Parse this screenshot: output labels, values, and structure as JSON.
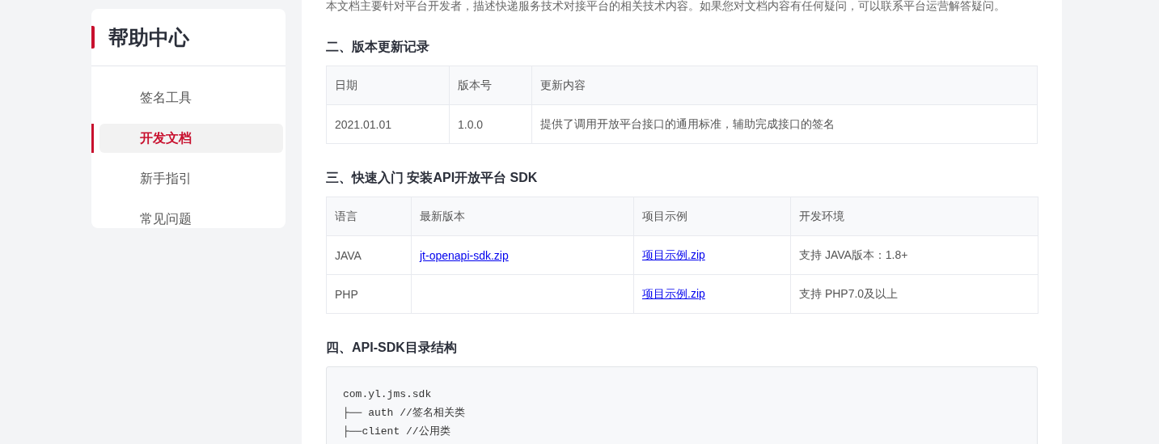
{
  "sidebar": {
    "title": "帮助中心",
    "items": [
      {
        "label": "签名工具",
        "selected": false
      },
      {
        "label": "开发文档",
        "selected": true
      },
      {
        "label": "新手指引",
        "selected": false
      },
      {
        "label": "常见问题",
        "selected": false
      }
    ]
  },
  "intro": "本文档主要针对平台开发者，描述快递服务技术对接平台的相关技术内容。如果您对文档内容有任何疑问，可以联系平台运营解答疑问。",
  "sections": [
    {
      "heading": "二、版本更新记录",
      "kind": "table",
      "table": {
        "columns": [
          "日期",
          "版本号",
          "更新内容"
        ],
        "rows": [
          [
            {
              "text": "2021.01.01"
            },
            {
              "text": "1.0.0"
            },
            {
              "text": "提供了调用开放平台接口的通用标准，辅助完成接口的签名"
            }
          ]
        ]
      }
    },
    {
      "heading": "三、快速入门 安装API开放平台 SDK",
      "kind": "table",
      "table": {
        "columns": [
          "语言",
          "最新版本",
          "项目示例",
          "开发环境"
        ],
        "rows": [
          [
            {
              "text": "JAVA"
            },
            {
              "text": "jt-openapi-sdk.zip",
              "kind": "link"
            },
            {
              "text": "项目示例.zip",
              "kind": "link"
            },
            {
              "text": "支持 JAVA版本：1.8+"
            }
          ],
          [
            {
              "text": "PHP"
            },
            {},
            {
              "text": "项目示例.zip",
              "kind": "link"
            },
            {
              "text": "支持 PHP7.0及以上"
            }
          ]
        ]
      }
    },
    {
      "heading": "四、API-SDK目录结构",
      "kind": "code",
      "lines": [
        "com.yl.jms.sdk",
        "├── auth //签名相关类",
        "├──client //公用类"
      ]
    }
  ]
}
